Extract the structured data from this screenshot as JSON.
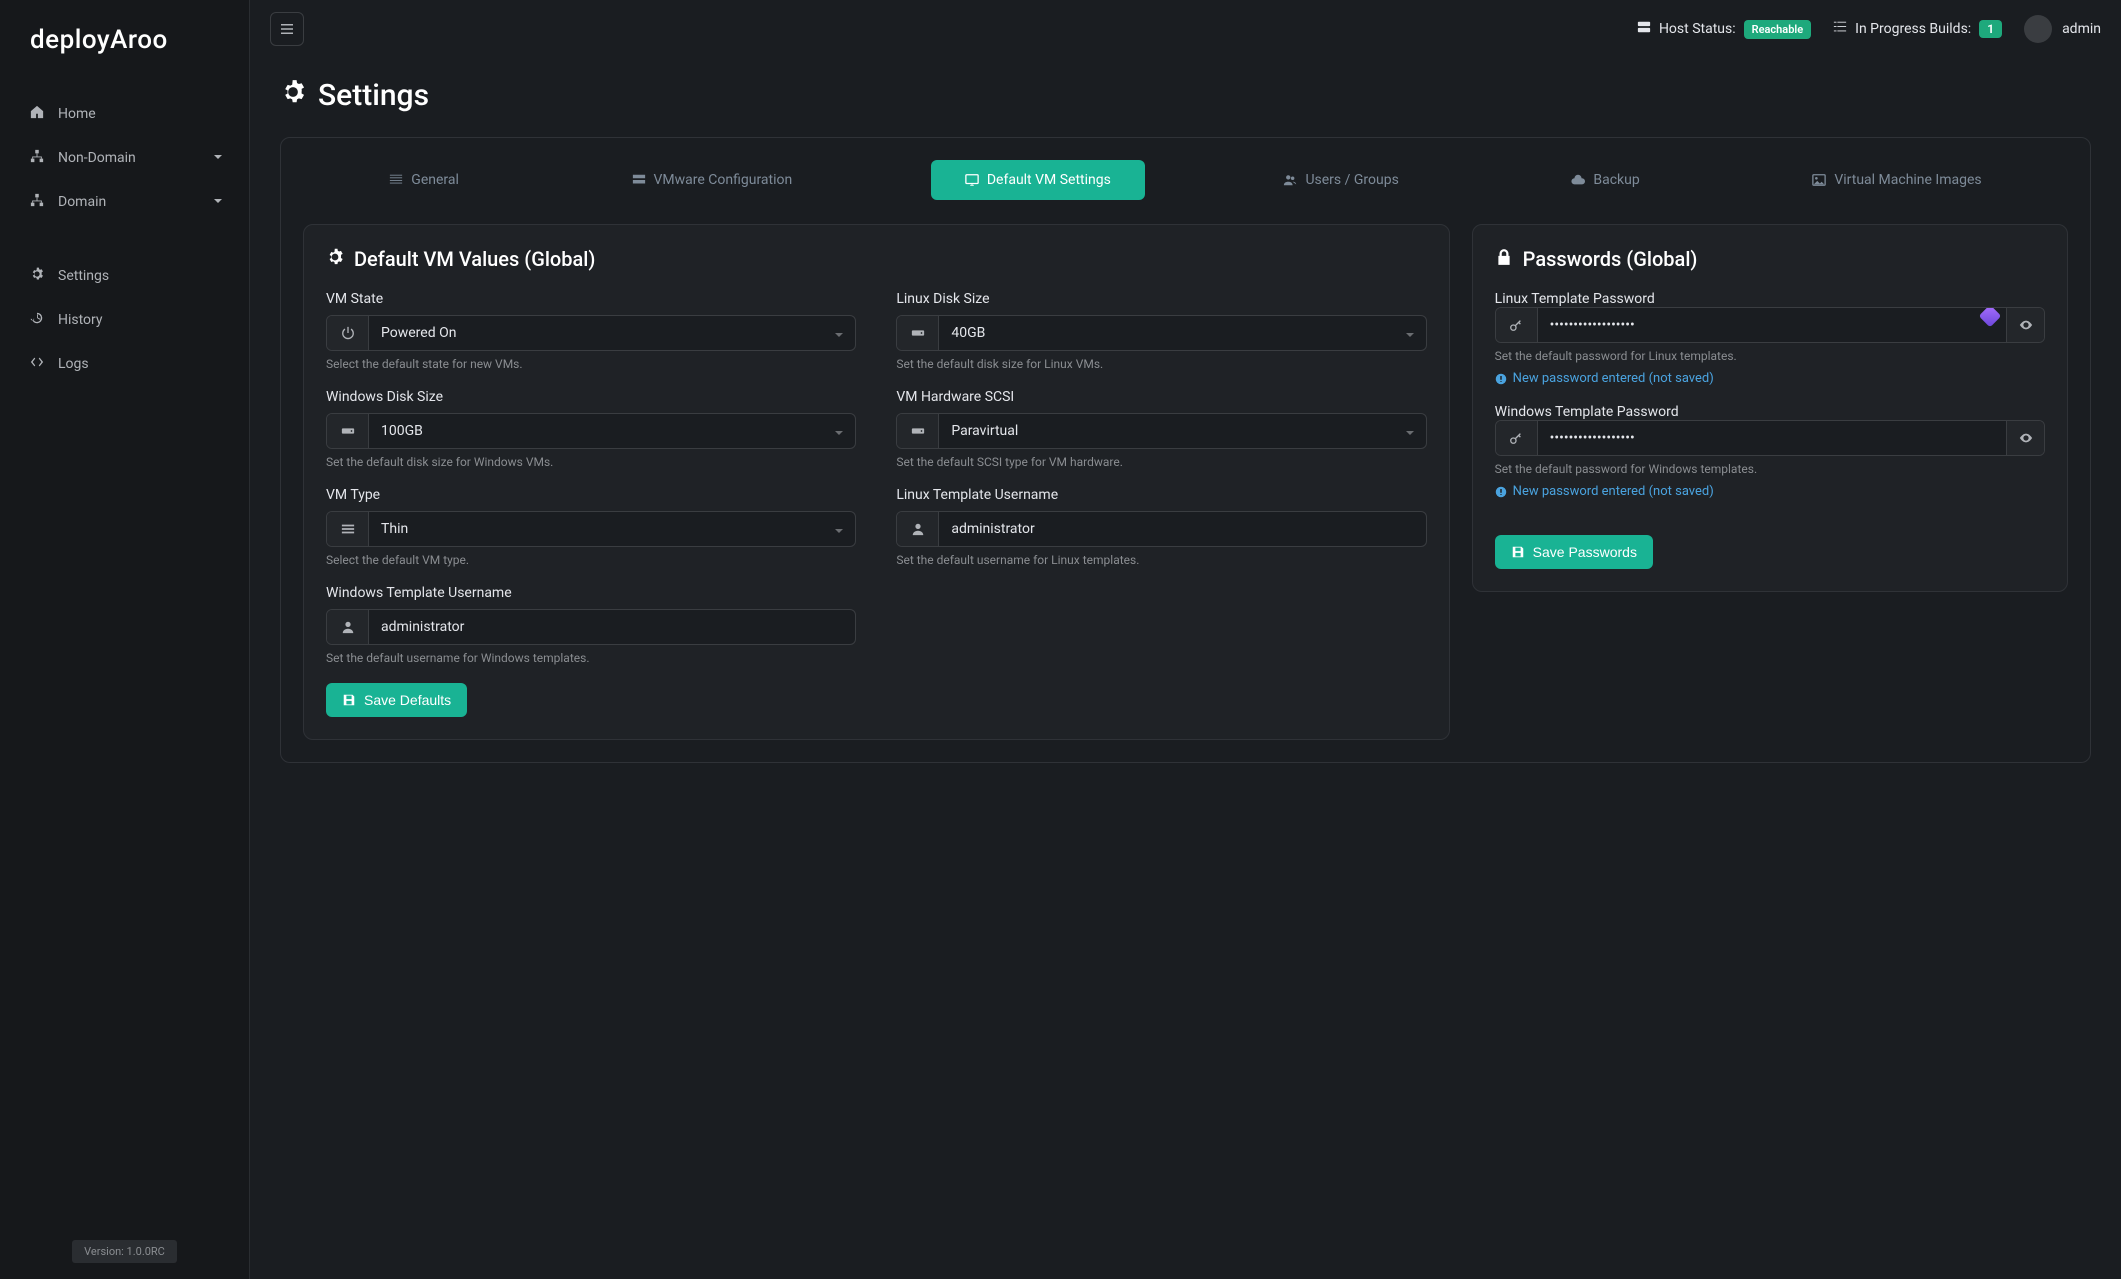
{
  "app": {
    "logo": "deployAroo",
    "version": "Version: 1.0.0RC"
  },
  "sidebar": {
    "items": [
      {
        "label": "Home"
      },
      {
        "label": "Non-Domain"
      },
      {
        "label": "Domain"
      },
      {
        "label": "Settings"
      },
      {
        "label": "History"
      },
      {
        "label": "Logs"
      }
    ]
  },
  "topbar": {
    "hostStatusLabel": "Host Status:",
    "hostStatusBadge": "Reachable",
    "builds": {
      "label": "In Progress Builds:",
      "count": "1"
    },
    "user": "admin"
  },
  "page": {
    "title": "Settings"
  },
  "tabs": [
    {
      "label": "General"
    },
    {
      "label": "VMware Configuration"
    },
    {
      "label": "Default VM Settings"
    },
    {
      "label": "Users / Groups"
    },
    {
      "label": "Backup"
    },
    {
      "label": "Virtual Machine Images"
    }
  ],
  "defaults": {
    "title": "Default VM Values (Global)",
    "vmState": {
      "label": "VM State",
      "value": "Powered On",
      "help": "Select the default state for new VMs."
    },
    "linuxDisk": {
      "label": "Linux Disk Size",
      "value": "40GB",
      "help": "Set the default disk size for Linux VMs."
    },
    "winDisk": {
      "label": "Windows Disk Size",
      "value": "100GB",
      "help": "Set the default disk size for Windows VMs."
    },
    "scsi": {
      "label": "VM Hardware SCSI",
      "value": "Paravirtual",
      "help": "Set the default SCSI type for VM hardware."
    },
    "vmType": {
      "label": "VM Type",
      "value": "Thin",
      "help": "Select the default VM type."
    },
    "linuxUser": {
      "label": "Linux Template Username",
      "value": "administrator",
      "help": "Set the default username for Linux templates."
    },
    "winUser": {
      "label": "Windows Template Username",
      "value": "administrator",
      "help": "Set the default username for Windows templates."
    },
    "saveBtn": "Save Defaults"
  },
  "passwords": {
    "title": "Passwords (Global)",
    "linux": {
      "label": "Linux Template Password",
      "value": "••••••••••••••••••",
      "help": "Set the default password for Linux templates."
    },
    "windows": {
      "label": "Windows Template Password",
      "value": "••••••••••••••••••",
      "help": "Set the default password for Windows templates."
    },
    "changed": "New password entered (not saved)",
    "saveBtn": "Save Passwords"
  }
}
